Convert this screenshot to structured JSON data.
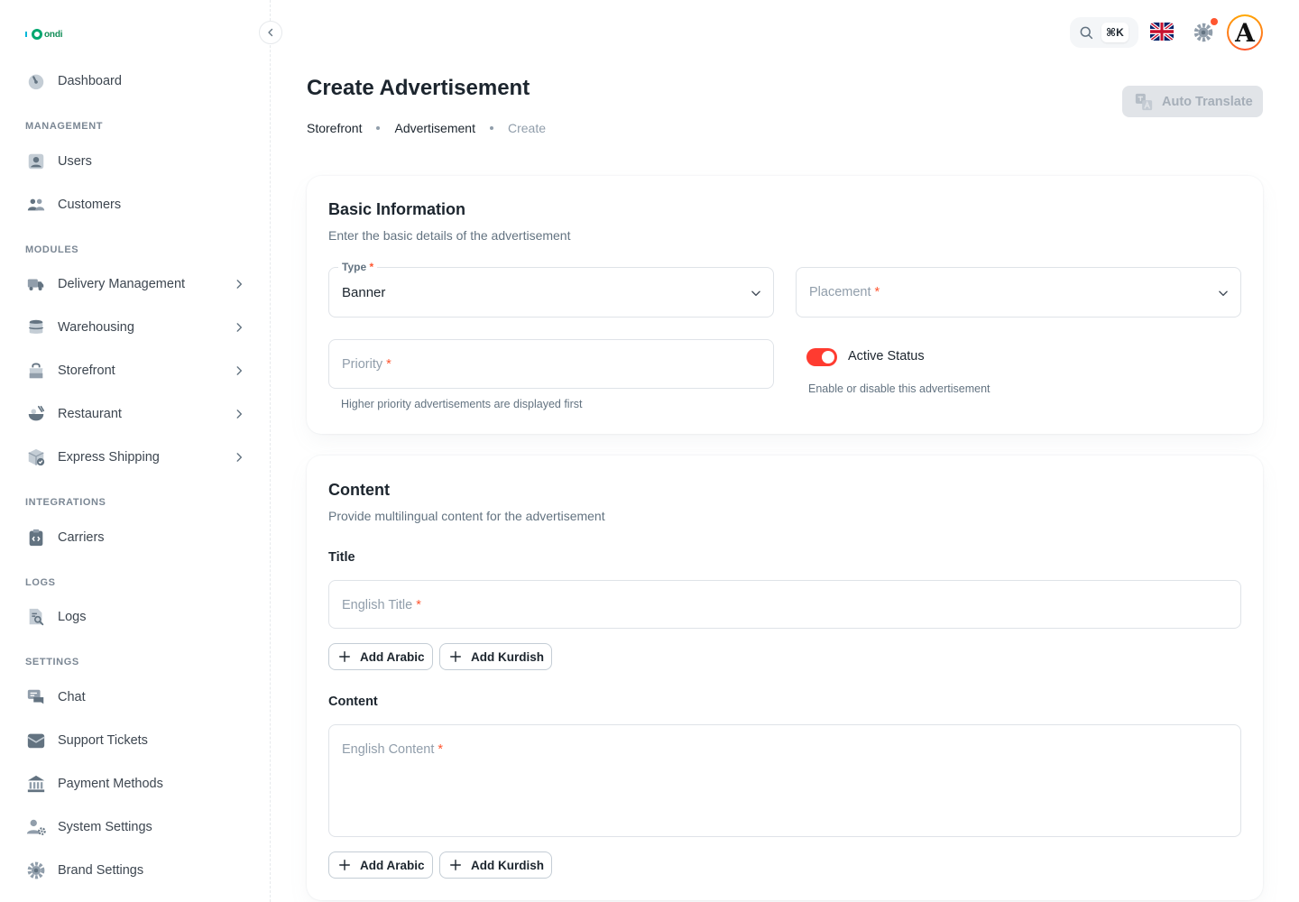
{
  "brand": {
    "name": "ondi"
  },
  "sidebar": {
    "dashboard": "Dashboard",
    "sections": {
      "management": "MANAGEMENT",
      "modules": "MODULES",
      "integrations": "INTEGRATIONS",
      "logs": "LOGS",
      "settings": "SETTINGS"
    },
    "items": {
      "users": "Users",
      "customers": "Customers",
      "delivery": "Delivery Management",
      "warehousing": "Warehousing",
      "storefront": "Storefront",
      "restaurant": "Restaurant",
      "express": "Express Shipping",
      "carriers": "Carriers",
      "logs": "Logs",
      "chat": "Chat",
      "support": "Support Tickets",
      "payment": "Payment Methods",
      "system": "System Settings",
      "brand": "Brand Settings"
    }
  },
  "header": {
    "search_shortcut": "⌘K",
    "avatar_initial": "A",
    "colors": {
      "accent": "#00a76f",
      "notification": "#ff5630",
      "toggle_on": "#ff3b30"
    }
  },
  "page": {
    "title": "Create Advertisement",
    "breadcrumb": [
      "Storefront",
      "Advertisement",
      "Create"
    ],
    "auto_translate": "Auto Translate"
  },
  "basic_info": {
    "title": "Basic Information",
    "subtitle": "Enter the basic details of the advertisement",
    "type_label": "Type",
    "type_value": "Banner",
    "placement_placeholder": "Placement",
    "priority_placeholder": "Priority",
    "priority_helper": "Higher priority advertisements are displayed first",
    "active_status_label": "Active Status",
    "active_status_on": true,
    "active_status_helper": "Enable or disable this advertisement",
    "required_mark": "*"
  },
  "content": {
    "title": "Content",
    "subtitle": "Provide multilingual content for the advertisement",
    "title_heading": "Title",
    "english_title_placeholder": "English Title",
    "content_heading": "Content",
    "english_content_placeholder": "English Content",
    "add_arabic": "Add Arabic",
    "add_kurdish": "Add Kurdish",
    "required_mark": "*"
  }
}
